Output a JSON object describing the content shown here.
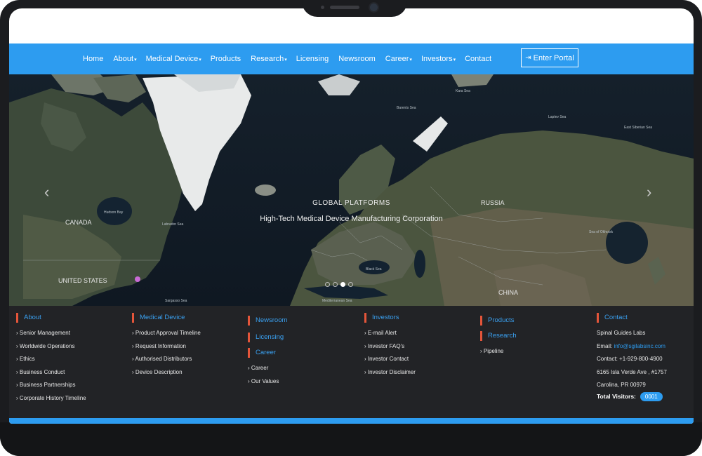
{
  "nav": {
    "items": [
      {
        "label": "Home",
        "caret": ""
      },
      {
        "label": "About",
        "caret": "▾"
      },
      {
        "label": "Medical Device",
        "caret": "▾"
      },
      {
        "label": "Products",
        "caret": ""
      },
      {
        "label": "Research",
        "caret": "▾"
      },
      {
        "label": "Licensing",
        "caret": ""
      },
      {
        "label": "Newsroom",
        "caret": ""
      },
      {
        "label": "Career",
        "caret": "▾"
      },
      {
        "label": "Investors",
        "caret": "▾"
      },
      {
        "label": "Contact",
        "caret": ""
      }
    ],
    "portal_label": "Enter Portal",
    "portal_icon": "sign-in-icon"
  },
  "hero": {
    "title": "GLOBAL PLATFORMS",
    "subtitle": "High-Tech Medical Device Manufacturing Corporation",
    "labels": {
      "canada": "CANADA",
      "usa": "UNITED STATES",
      "russia": "RUSSIA",
      "china": "CHINA",
      "hudson": "Hudson Bay",
      "labrador": "Labrador Sea",
      "barents": "Barents Sea",
      "kara": "Kara Sea",
      "laptev": "Laptev Sea",
      "siberian": "East Siberian Sea",
      "okhotsk": "Sea of Okhotsk",
      "black": "Black Sea",
      "med": "Mediterranean Sea",
      "sargasso": "Sargasso Sea"
    },
    "slide_count": 4,
    "active_slide": 3
  },
  "footer": {
    "about": {
      "heading": "About",
      "links": [
        "› Senior Management",
        "› Worldwide Operations",
        "› Ethics",
        "› Business Conduct",
        "› Business Partnerships",
        "› Corporate History Timeline"
      ]
    },
    "medical": {
      "heading": "Medical Device",
      "links": [
        "› Product Approval Timeline",
        "› Request Information",
        "› Authorised Distributors",
        "› Device Description"
      ]
    },
    "newsroom": {
      "heading": "Newsroom"
    },
    "licensing": {
      "heading": "Licensing"
    },
    "career": {
      "heading": "Career",
      "links": [
        "› Career",
        "› Our Values"
      ]
    },
    "investors": {
      "heading": "Investors",
      "links": [
        "› E-mail Alert",
        "› Investor FAQ's",
        "› Investor Contact",
        "› Investor Disclaimer"
      ]
    },
    "products": {
      "heading": "Products"
    },
    "research": {
      "heading": "Research",
      "links": [
        "› Pipeline"
      ]
    },
    "contact": {
      "heading": "Contact",
      "company": "Spinal Guides Labs",
      "email_label": "Email: ",
      "email": "info@sgilabsinc.com",
      "phone": "Contact: +1-929-800-4900",
      "address1": "6165 Isla Verde Ave , #1757",
      "address2": "Carolina, PR 00979",
      "visitors_label": "Total Visitors:",
      "visitors_count": "0001"
    }
  }
}
